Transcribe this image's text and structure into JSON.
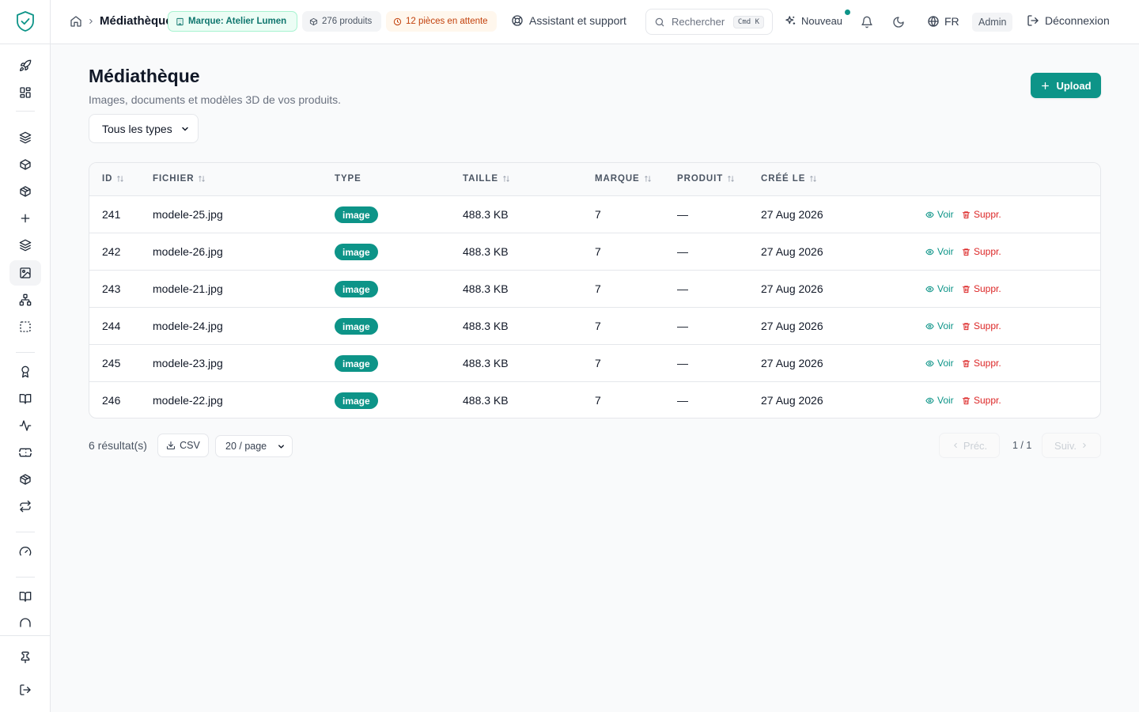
{
  "header": {
    "breadcrumb_title": "Médiathèque",
    "brand_pill": "Marque: Atelier Lumen",
    "products_pill": "276 produits",
    "pending_pill": "12 pièces en attente",
    "support_label": "Assistant et support",
    "search_placeholder": "Rechercher",
    "search_shortcut": "Cmd K",
    "new_label": "Nouveau",
    "language": "FR",
    "role_badge": "Admin",
    "logout_label": "Déconnexion"
  },
  "page": {
    "title": "Médiathèque",
    "subtitle": "Images, documents et modèles 3D de vos produits.",
    "upload_label": "Upload",
    "type_filter": "Tous les types"
  },
  "table": {
    "columns": [
      "ID",
      "FICHIER",
      "TYPE",
      "TAILLE",
      "MARQUE",
      "PRODUIT",
      "CRÉÉ LE"
    ],
    "view_label": "Voir",
    "delete_label": "Suppr.",
    "rows": [
      {
        "id": "241",
        "file": "modele-25.jpg",
        "type": "image",
        "size": "488.3 KB",
        "brand": "7",
        "product": "—",
        "created": "27 Aug 2026"
      },
      {
        "id": "242",
        "file": "modele-26.jpg",
        "type": "image",
        "size": "488.3 KB",
        "brand": "7",
        "product": "—",
        "created": "27 Aug 2026"
      },
      {
        "id": "243",
        "file": "modele-21.jpg",
        "type": "image",
        "size": "488.3 KB",
        "brand": "7",
        "product": "—",
        "created": "27 Aug 2026"
      },
      {
        "id": "244",
        "file": "modele-24.jpg",
        "type": "image",
        "size": "488.3 KB",
        "brand": "7",
        "product": "—",
        "created": "27 Aug 2026"
      },
      {
        "id": "245",
        "file": "modele-23.jpg",
        "type": "image",
        "size": "488.3 KB",
        "brand": "7",
        "product": "—",
        "created": "27 Aug 2026"
      },
      {
        "id": "246",
        "file": "modele-22.jpg",
        "type": "image",
        "size": "488.3 KB",
        "brand": "7",
        "product": "—",
        "created": "27 Aug 2026"
      }
    ]
  },
  "footer": {
    "results": "6 résultat(s)",
    "csv_label": "CSV",
    "per_page": "20 / page",
    "prev_label": "Préc.",
    "next_label": "Suiv.",
    "page_info": "1 / 1"
  },
  "colors": {
    "accent": "#0d9488",
    "danger": "#dc2626",
    "pending": "#c2410c"
  },
  "sidebar": {
    "icons": [
      "rocket-icon",
      "dashboard-grid-icon",
      "layers-icon",
      "box-icon",
      "package-icon",
      "plus-icon",
      "layers-icon",
      "image-icon",
      "sitemap-icon",
      "selection-icon",
      "award-icon",
      "book-icon",
      "activity-icon",
      "ticket-icon",
      "package-check-icon",
      "repeat-icon",
      "gauge-icon",
      "book-open-icon",
      "headphones-icon",
      "pin-icon",
      "logout-icon"
    ]
  }
}
